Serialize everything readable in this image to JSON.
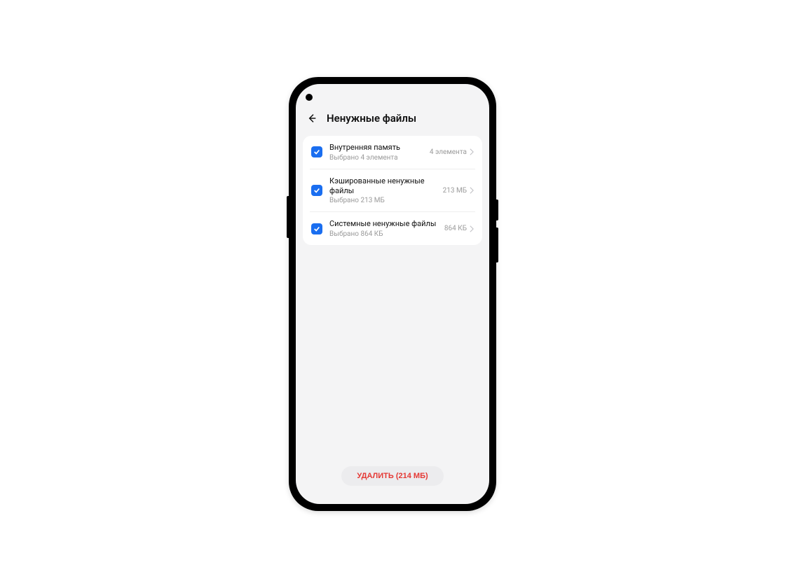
{
  "header": {
    "title": "Ненужные файлы"
  },
  "items": [
    {
      "title": "Внутренняя память",
      "subtitle": "Выбрано 4 элемента",
      "meta": "4 элемента",
      "checked": true
    },
    {
      "title": "Кэшированные ненужные файлы",
      "subtitle": "Выбрано 213 МБ",
      "meta": "213 МБ",
      "checked": true
    },
    {
      "title": "Системные ненужные файлы",
      "subtitle": "Выбрано 864 КБ",
      "meta": "864 КБ",
      "checked": true
    }
  ],
  "footer": {
    "delete_label": "УДАЛИТЬ (214 МБ)"
  }
}
